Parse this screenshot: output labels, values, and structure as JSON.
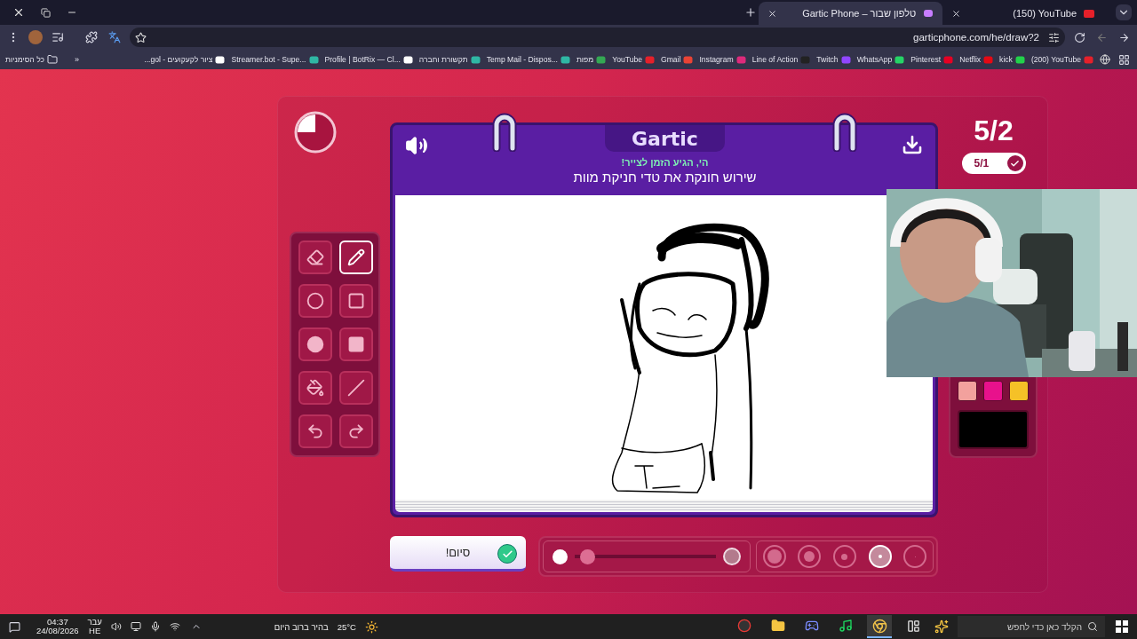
{
  "browser": {
    "tabs": [
      {
        "title": "(150) YouTube",
        "selected": false,
        "kind": "youtube"
      },
      {
        "title": "Gartic Phone – טלפון שבור",
        "selected": true,
        "kind": "phone"
      }
    ],
    "url": "garticphone.com/he/draw?2",
    "bookmarks": [
      {
        "title": "(200) YouTube",
        "kind": "youtube"
      },
      {
        "title": "kick",
        "kind": "kick"
      },
      {
        "title": "Netflix",
        "kind": "netflix"
      },
      {
        "title": "Pinterest",
        "kind": "pinterest"
      },
      {
        "title": "WhatsApp",
        "kind": "whatsapp"
      },
      {
        "title": "Twitch",
        "kind": "twitch"
      },
      {
        "title": "Line of Action",
        "kind": "figure"
      },
      {
        "title": "Instagram",
        "kind": "instagram"
      },
      {
        "title": "Gmail",
        "kind": "mail"
      },
      {
        "title": "YouTube",
        "kind": "youtube"
      },
      {
        "title": "מפות",
        "kind": "maps"
      },
      {
        "title": "Temp Mail - Dispos...",
        "kind": "globe"
      },
      {
        "title": "תקשורת וחברה",
        "kind": "globe"
      },
      {
        "title": "Profile | BotRix — Cl...",
        "kind": "bot"
      },
      {
        "title": "Streamer.bot - Supe...",
        "kind": "globe"
      },
      {
        "title": "ציור לקעקועים - gol..."
      }
    ],
    "more": "«",
    "all_bookmarks": "כל הסימניות"
  },
  "game": {
    "logo": "Gartic",
    "subtitle": "הי, הגיע הזמן לצייר!",
    "prompt": "שירוש חונקת את טדי חניקת מוות",
    "round": "5/2",
    "done_count": "5/1",
    "tools": [
      {
        "kind": "eraser",
        "selected": false
      },
      {
        "kind": "pencil",
        "selected": true
      },
      {
        "kind": "ellipse",
        "selected": false
      },
      {
        "kind": "rect",
        "selected": false
      },
      {
        "kind": "filled-ellipse",
        "selected": false
      },
      {
        "kind": "filled-rect",
        "selected": false
      },
      {
        "kind": "fill",
        "selected": false
      },
      {
        "kind": "line",
        "selected": false
      },
      {
        "kind": "undo",
        "selected": false
      },
      {
        "kind": "redo",
        "selected": false
      }
    ],
    "palette": [
      {
        "color": "#f2a19d"
      },
      {
        "color": "#e8118c"
      },
      {
        "color": "#f5c127"
      }
    ],
    "current_color": {
      "color": "#000000"
    },
    "finish_button": "סיום!",
    "opacity": {
      "level": 0.04
    },
    "brush_sizes": [
      {
        "selected": false
      },
      {
        "selected": false
      },
      {
        "selected": false
      },
      {
        "selected": true
      },
      {
        "selected": false
      }
    ]
  },
  "taskbar": {
    "search_placeholder": "הקלד כאן כדי לחפש",
    "weather": "בהיר ברוב היום",
    "temperature": "25°C",
    "language": [
      "עבר",
      "HE"
    ],
    "time": "04:37",
    "date": "24/08/2026"
  }
}
